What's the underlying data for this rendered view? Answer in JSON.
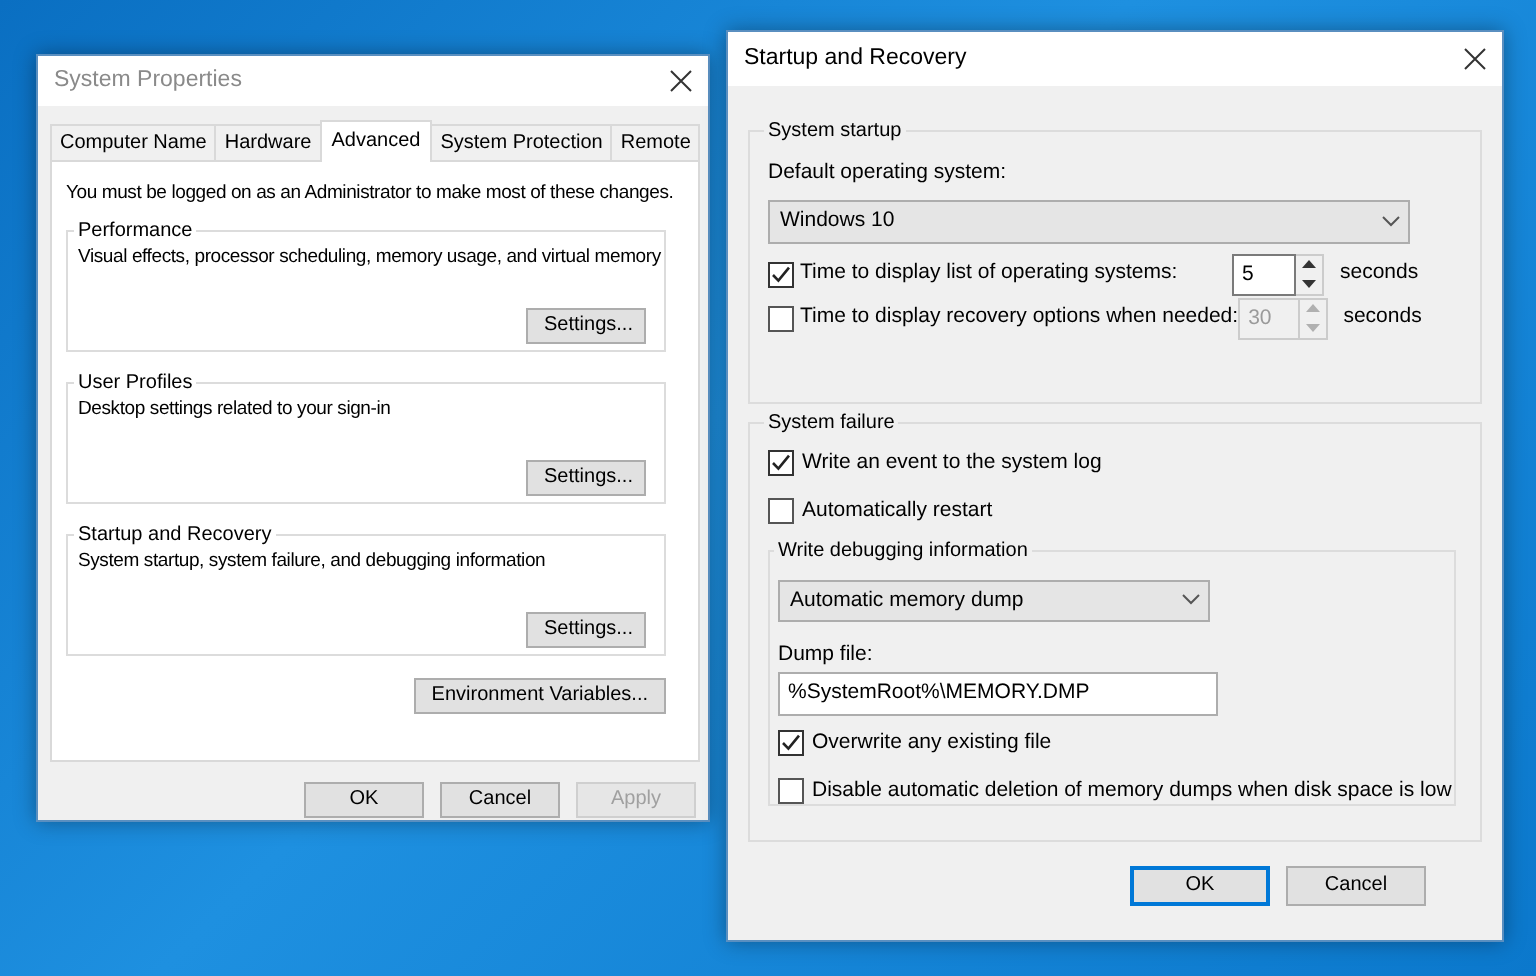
{
  "system_properties": {
    "title": "System Properties",
    "tabs": [
      {
        "label": "Computer Name",
        "selected": false
      },
      {
        "label": "Hardware",
        "selected": false
      },
      {
        "label": "Advanced",
        "selected": true
      },
      {
        "label": "System Protection",
        "selected": false
      },
      {
        "label": "Remote",
        "selected": false
      }
    ],
    "notice": "You must be logged on as an Administrator to make most of these changes.",
    "groups": [
      {
        "title": "Performance",
        "description": "Visual effects, processor scheduling, memory usage, and virtual memory",
        "button": "Settings..."
      },
      {
        "title": "User Profiles",
        "description": "Desktop settings related to your sign-in",
        "button": "Settings..."
      },
      {
        "title": "Startup and Recovery",
        "description": "System startup, system failure, and debugging information",
        "button": "Settings..."
      }
    ],
    "env_button": "Environment Variables...",
    "buttons": [
      {
        "label": "OK",
        "disabled": false
      },
      {
        "label": "Cancel",
        "disabled": false
      },
      {
        "label": "Apply",
        "disabled": true
      }
    ]
  },
  "startup_recovery": {
    "title": "Startup and Recovery",
    "system_startup": {
      "title": "System startup",
      "default_os_label": "Default operating system:",
      "default_os": "Windows 10",
      "timers": [
        {
          "label": "Time to display list of operating systems:",
          "checked": true,
          "value": "5",
          "unit": "seconds",
          "disabled": false
        },
        {
          "label": "Time to display recovery options when needed:",
          "checked": false,
          "value": "30",
          "unit": "seconds",
          "disabled": true
        }
      ]
    },
    "system_failure": {
      "title": "System failure",
      "options": [
        {
          "label": "Write an event to the system log",
          "checked": true
        },
        {
          "label": "Automatically restart",
          "checked": false
        }
      ],
      "debugging": {
        "title": "Write debugging information",
        "dump_type": "Automatic memory dump",
        "dump_file_label": "Dump file:",
        "dump_file": "%SystemRoot%\\MEMORY.DMP",
        "options": [
          {
            "label": "Overwrite any existing file",
            "checked": true
          },
          {
            "label": "Disable automatic deletion of memory dumps when disk space is low",
            "checked": false
          }
        ]
      }
    },
    "buttons": [
      {
        "label": "OK",
        "default": true
      },
      {
        "label": "Cancel",
        "default": false
      }
    ]
  }
}
